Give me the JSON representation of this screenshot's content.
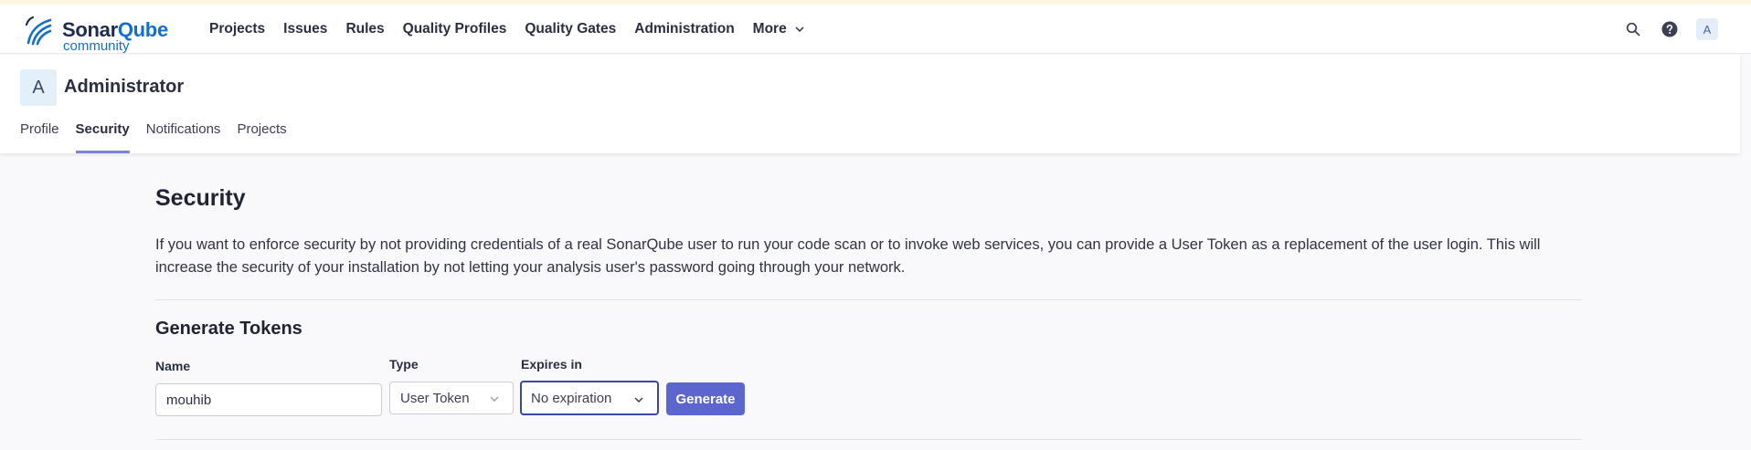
{
  "navbar": {
    "logo_text": "SonarQube",
    "logo_subtitle": "community",
    "links": [
      {
        "label": "Projects"
      },
      {
        "label": "Issues"
      },
      {
        "label": "Rules"
      },
      {
        "label": "Quality Profiles"
      },
      {
        "label": "Quality Gates"
      },
      {
        "label": "Administration"
      },
      {
        "label": "More"
      }
    ],
    "user_initial": "A",
    "icons": [
      "search-icon",
      "help-icon",
      "avatar"
    ]
  },
  "account": {
    "initial": "A",
    "name": "Administrator",
    "tabs": [
      {
        "label": "Profile",
        "active": false
      },
      {
        "label": "Security",
        "active": true
      },
      {
        "label": "Notifications",
        "active": false
      },
      {
        "label": "Projects",
        "active": false
      }
    ]
  },
  "security": {
    "title": "Security",
    "description": "If you want to enforce security by not providing credentials of a real SonarQube user to run your code scan or to invoke web services, you can provide a User Token as a replacement of the user login. This will increase the security of your installation by not letting your analysis user's password going through your network.",
    "generate": {
      "title": "Generate Tokens",
      "name_label": "Name",
      "name_value": "mouhib",
      "type_label": "Type",
      "type_value": "User Token",
      "expires_label": "Expires in",
      "expires_value": "No expiration",
      "button_label": "Generate"
    }
  },
  "colors": {
    "accent": "#5b66cf",
    "tab_underline": "#7b83d6",
    "brand_blue": "#126ed3",
    "top_strip": "#fdf4e3"
  }
}
